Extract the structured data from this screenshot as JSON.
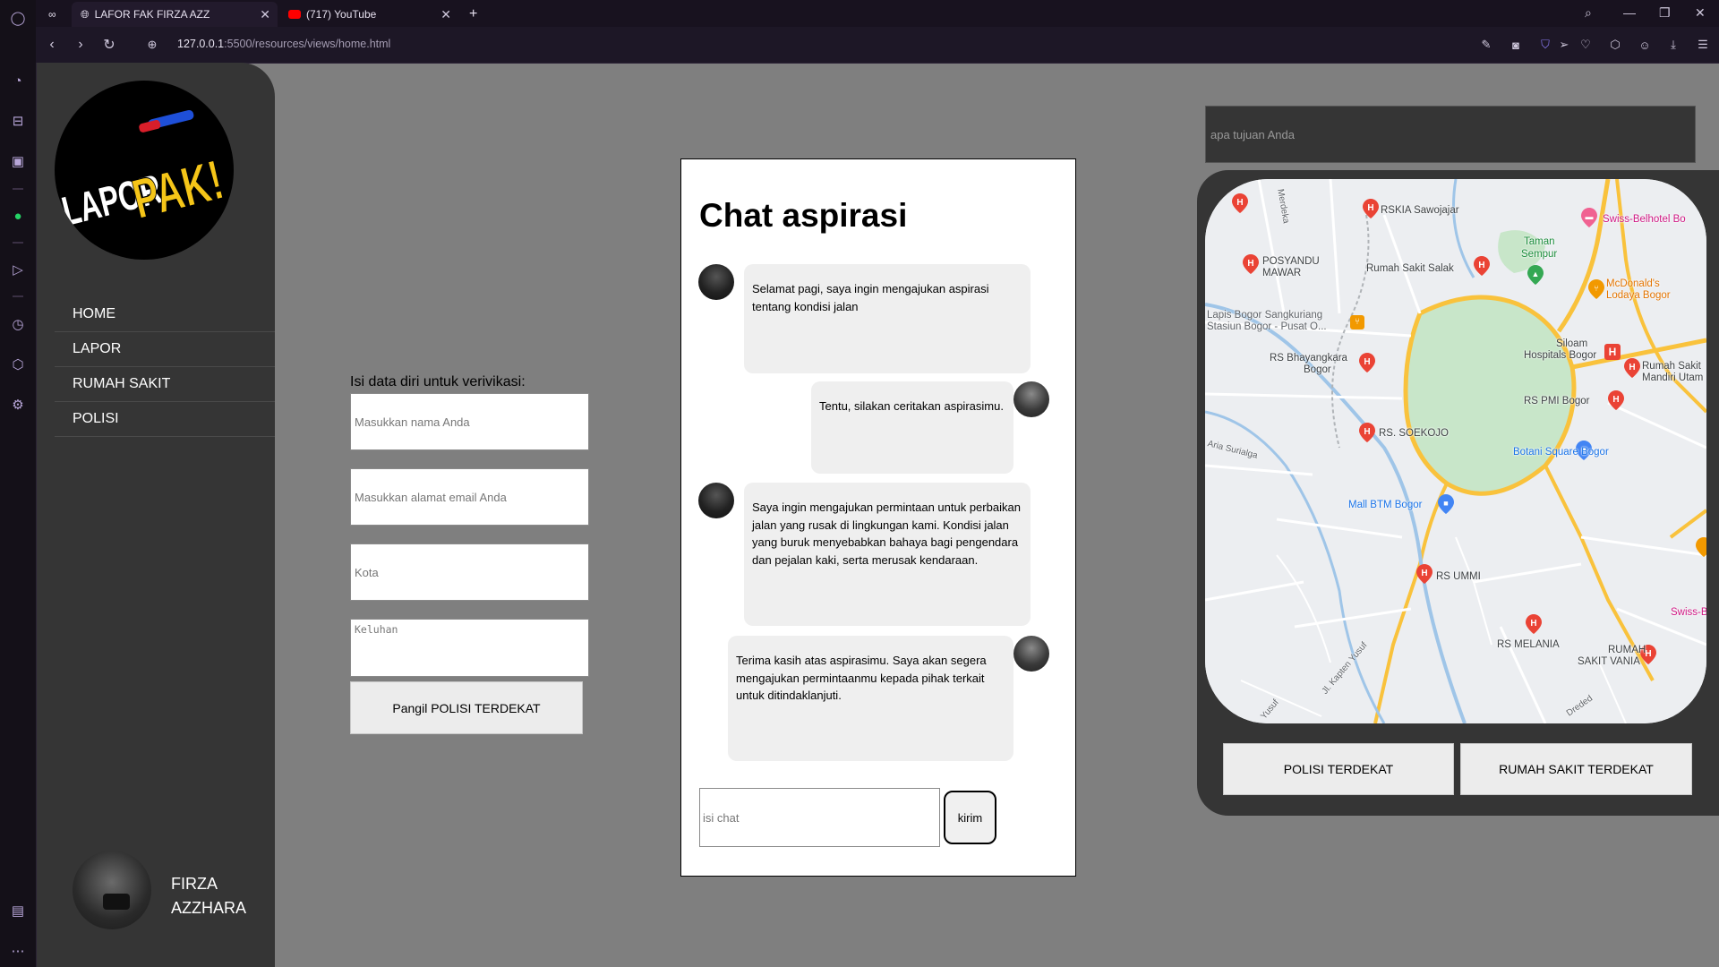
{
  "browser": {
    "tabs": [
      {
        "label": "LAFOR FAK FIRZA AZZ",
        "active": true
      },
      {
        "label": "(717) YouTube",
        "active": false
      }
    ],
    "url_host": "127.0.0.1",
    "url_path": ":5500/resources/views/home.html"
  },
  "sidebar": {
    "logo_text_1": "LAPOR",
    "logo_text_2": "PAK!",
    "nav": [
      {
        "label": "HOME"
      },
      {
        "label": "LAPOR"
      },
      {
        "label": "RUMAH SAKIT"
      },
      {
        "label": "POLISI"
      }
    ],
    "user": {
      "name_line1": "FIRZA",
      "name_line2": "AZZHARA"
    }
  },
  "form": {
    "title": "Isi data diri untuk verivikasi:",
    "name_placeholder": "Masukkan nama Anda",
    "email_placeholder": "Masukkan alamat email Anda",
    "city_placeholder": "Kota",
    "complaint_placeholder": "Keluhan",
    "submit_label": "Pangil POLISI TERDEKAT"
  },
  "chat": {
    "title": "Chat aspirasi",
    "messages": [
      {
        "side": "left",
        "text": "Selamat pagi, saya ingin mengajukan aspirasi tentang kondisi jalan"
      },
      {
        "side": "right",
        "text": "Tentu, silakan ceritakan aspirasimu."
      },
      {
        "side": "left",
        "text": "Saya ingin mengajukan permintaan untuk perbaikan jalan yang rusak di lingkungan kami. Kondisi jalan yang buruk menyebabkan bahaya bagi pengendara dan pejalan kaki, serta merusak kendaraan."
      },
      {
        "side": "right",
        "text": "Terima kasih atas aspirasimu. Saya akan segera mengajukan permintaanmu kepada pihak terkait untuk ditindaklanjuti."
      }
    ],
    "input_placeholder": "isi chat",
    "send_label": "kirim"
  },
  "right_panel": {
    "destination_placeholder": "apa tujuan Anda",
    "police_button": "POLISI TERDEKAT",
    "hospital_button": "RUMAH SAKIT  TERDEKAT"
  },
  "map_labels": {
    "rskia": "RSKIA Sawojajar",
    "swiss_top": "Swiss-Belhotel Bo",
    "merdeka": "Merdeka",
    "taman_1": "Taman",
    "taman_2": "Sempur",
    "posyandu_1": "POSYANDU",
    "posyandu_2": "MAWAR",
    "salak": "Rumah Sakit Salak",
    "mcd_1": "McDonald's",
    "mcd_2": "Lodaya Bogor",
    "lapis_1": "Lapis Bogor Sangkuriang",
    "lapis_2": "Stasiun Bogor - Pusat O...",
    "siloam_1": "Siloam",
    "siloam_2": "Hospitals Bogor",
    "mandiri_1": "Rumah Sakit",
    "mandiri_2": "Mandiri Utam",
    "bhayangkara_1": "RS Bhayangkara",
    "bhayangkara_2": "Bogor",
    "pmi": "RS PMI Bogor",
    "soekojo": "RS. SOEKOJO",
    "botani": "Botani Square Bogor",
    "aria": "Aria Surialga",
    "btm": "Mall BTM Bogor",
    "ummi": "RS UMMI",
    "swiss_bot": "Swiss-Be",
    "melania": "RS MELANIA",
    "vania_1": "RUMAH",
    "vania_2": "SAKIT VANIA",
    "yusuf": "Jl. Kapten Yusuf",
    "yusuf2": "Yusuf",
    "dreded": "Dreded"
  }
}
